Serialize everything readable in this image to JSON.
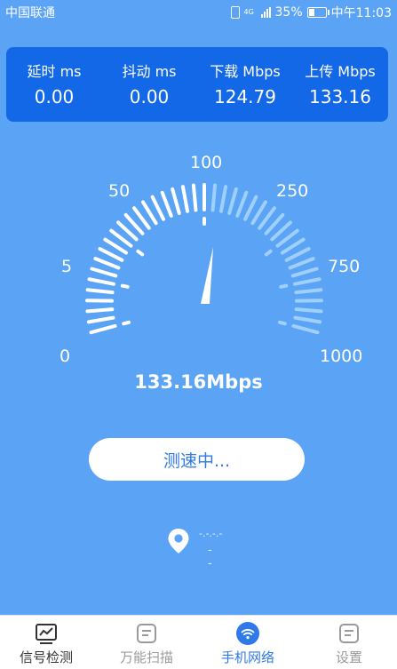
{
  "status_bar": {
    "carrier": "中国联通",
    "network": "4G",
    "battery": "35%",
    "time": "中午11:03"
  },
  "stats": [
    {
      "label": "延时 ms",
      "value": "0.00"
    },
    {
      "label": "抖动 ms",
      "value": "0.00"
    },
    {
      "label": "下载 Mbps",
      "value": "124.79"
    },
    {
      "label": "上传 Mbps",
      "value": "133.16"
    }
  ],
  "gauge": {
    "scale_labels": [
      "0",
      "5",
      "50",
      "100",
      "250",
      "750",
      "1000"
    ],
    "current_speed_mbps": 133.16,
    "readout": "133.16Mbps",
    "colors": {
      "active": "#ffffff",
      "inactive": "#9fd0fb",
      "background": "#5aa3f5"
    }
  },
  "test_button": {
    "label": "测速中..."
  },
  "location": {
    "line1": "-.-.-.-",
    "line2": "--"
  },
  "tabs": [
    {
      "label": "信号检测",
      "icon": "chart-icon",
      "active": false,
      "color": "#333333"
    },
    {
      "label": "万能扫描",
      "icon": "list-box-icon",
      "active": false,
      "color": "#9a9a9a"
    },
    {
      "label": "手机网络",
      "icon": "wifi-icon",
      "active": true,
      "color": "#2f7ae6"
    },
    {
      "label": "设置",
      "icon": "settings-box-icon",
      "active": false,
      "color": "#9a9a9a"
    }
  ]
}
